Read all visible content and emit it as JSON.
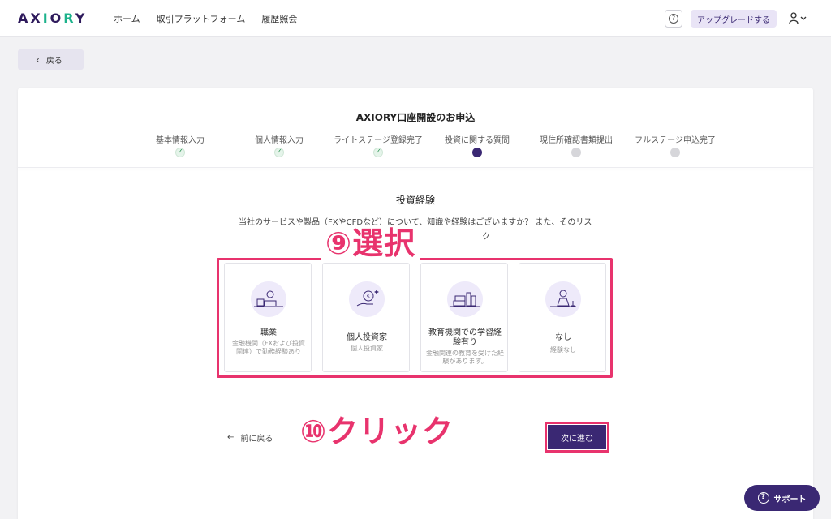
{
  "header": {
    "logo": "AXIORY",
    "nav": [
      "ホーム",
      "取引プラットフォーム",
      "履歴照会"
    ],
    "help_icon": "?",
    "upgrade_label": "アップグレードする"
  },
  "back_label": "戻る",
  "card": {
    "title": "AXIORY口座開設のお申込",
    "steps": [
      {
        "label": "基本情報入力",
        "state": "done"
      },
      {
        "label": "個人情報入力",
        "state": "done"
      },
      {
        "label": "ライトステージ登録完了",
        "state": "done"
      },
      {
        "label": "投資に関する質問",
        "state": "current"
      },
      {
        "label": "現住所確認書類提出",
        "state": "pending"
      },
      {
        "label": "フルステージ申込完了",
        "state": "pending"
      }
    ],
    "question_title": "投資経験",
    "question_desc": "当社のサービスや製品（FXやCFDなど）について、知識や経験はございますか？ また、そのリス",
    "question_desc_2": "ク",
    "options": [
      {
        "title": "職業",
        "sub": "金融機関（FXおよび投資関連）で勤務経験あり"
      },
      {
        "title": "個人投資家",
        "sub": "個人投資家"
      },
      {
        "title": "教育機関での学習経験有り",
        "sub": "金融関連の教育を受けた経験があります。"
      },
      {
        "title": "なし",
        "sub": "経験なし"
      }
    ],
    "prev_label": "前に戻る",
    "next_label": "次に進む"
  },
  "annotations": {
    "select": "⑨選択",
    "click": "⑩クリック"
  },
  "support_label": "サポート",
  "colors": {
    "brand": "#3a2873",
    "accent_green": "#1cb28b",
    "annotation": "#e8336d"
  }
}
